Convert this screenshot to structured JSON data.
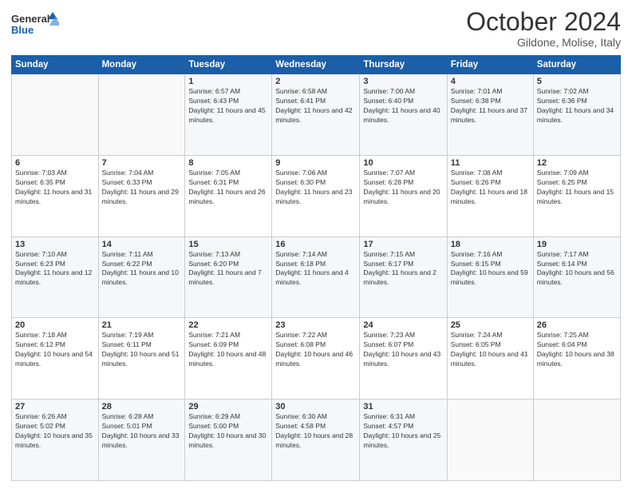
{
  "header": {
    "title": "October 2024",
    "location": "Gildone, Molise, Italy"
  },
  "calendar": {
    "days": [
      "Sunday",
      "Monday",
      "Tuesday",
      "Wednesday",
      "Thursday",
      "Friday",
      "Saturday"
    ]
  },
  "weeks": [
    [
      {
        "day": "",
        "sunrise": "",
        "sunset": "",
        "daylight": ""
      },
      {
        "day": "",
        "sunrise": "",
        "sunset": "",
        "daylight": ""
      },
      {
        "day": "1",
        "sunrise": "Sunrise: 6:57 AM",
        "sunset": "Sunset: 6:43 PM",
        "daylight": "Daylight: 11 hours and 45 minutes."
      },
      {
        "day": "2",
        "sunrise": "Sunrise: 6:58 AM",
        "sunset": "Sunset: 6:41 PM",
        "daylight": "Daylight: 11 hours and 42 minutes."
      },
      {
        "day": "3",
        "sunrise": "Sunrise: 7:00 AM",
        "sunset": "Sunset: 6:40 PM",
        "daylight": "Daylight: 11 hours and 40 minutes."
      },
      {
        "day": "4",
        "sunrise": "Sunrise: 7:01 AM",
        "sunset": "Sunset: 6:38 PM",
        "daylight": "Daylight: 11 hours and 37 minutes."
      },
      {
        "day": "5",
        "sunrise": "Sunrise: 7:02 AM",
        "sunset": "Sunset: 6:36 PM",
        "daylight": "Daylight: 11 hours and 34 minutes."
      }
    ],
    [
      {
        "day": "6",
        "sunrise": "Sunrise: 7:03 AM",
        "sunset": "Sunset: 6:35 PM",
        "daylight": "Daylight: 11 hours and 31 minutes."
      },
      {
        "day": "7",
        "sunrise": "Sunrise: 7:04 AM",
        "sunset": "Sunset: 6:33 PM",
        "daylight": "Daylight: 11 hours and 29 minutes."
      },
      {
        "day": "8",
        "sunrise": "Sunrise: 7:05 AM",
        "sunset": "Sunset: 6:31 PM",
        "daylight": "Daylight: 11 hours and 26 minutes."
      },
      {
        "day": "9",
        "sunrise": "Sunrise: 7:06 AM",
        "sunset": "Sunset: 6:30 PM",
        "daylight": "Daylight: 11 hours and 23 minutes."
      },
      {
        "day": "10",
        "sunrise": "Sunrise: 7:07 AM",
        "sunset": "Sunset: 6:28 PM",
        "daylight": "Daylight: 11 hours and 20 minutes."
      },
      {
        "day": "11",
        "sunrise": "Sunrise: 7:08 AM",
        "sunset": "Sunset: 6:26 PM",
        "daylight": "Daylight: 11 hours and 18 minutes."
      },
      {
        "day": "12",
        "sunrise": "Sunrise: 7:09 AM",
        "sunset": "Sunset: 6:25 PM",
        "daylight": "Daylight: 11 hours and 15 minutes."
      }
    ],
    [
      {
        "day": "13",
        "sunrise": "Sunrise: 7:10 AM",
        "sunset": "Sunset: 6:23 PM",
        "daylight": "Daylight: 11 hours and 12 minutes."
      },
      {
        "day": "14",
        "sunrise": "Sunrise: 7:11 AM",
        "sunset": "Sunset: 6:22 PM",
        "daylight": "Daylight: 11 hours and 10 minutes."
      },
      {
        "day": "15",
        "sunrise": "Sunrise: 7:13 AM",
        "sunset": "Sunset: 6:20 PM",
        "daylight": "Daylight: 11 hours and 7 minutes."
      },
      {
        "day": "16",
        "sunrise": "Sunrise: 7:14 AM",
        "sunset": "Sunset: 6:18 PM",
        "daylight": "Daylight: 11 hours and 4 minutes."
      },
      {
        "day": "17",
        "sunrise": "Sunrise: 7:15 AM",
        "sunset": "Sunset: 6:17 PM",
        "daylight": "Daylight: 11 hours and 2 minutes."
      },
      {
        "day": "18",
        "sunrise": "Sunrise: 7:16 AM",
        "sunset": "Sunset: 6:15 PM",
        "daylight": "Daylight: 10 hours and 59 minutes."
      },
      {
        "day": "19",
        "sunrise": "Sunrise: 7:17 AM",
        "sunset": "Sunset: 6:14 PM",
        "daylight": "Daylight: 10 hours and 56 minutes."
      }
    ],
    [
      {
        "day": "20",
        "sunrise": "Sunrise: 7:18 AM",
        "sunset": "Sunset: 6:12 PM",
        "daylight": "Daylight: 10 hours and 54 minutes."
      },
      {
        "day": "21",
        "sunrise": "Sunrise: 7:19 AM",
        "sunset": "Sunset: 6:11 PM",
        "daylight": "Daylight: 10 hours and 51 minutes."
      },
      {
        "day": "22",
        "sunrise": "Sunrise: 7:21 AM",
        "sunset": "Sunset: 6:09 PM",
        "daylight": "Daylight: 10 hours and 48 minutes."
      },
      {
        "day": "23",
        "sunrise": "Sunrise: 7:22 AM",
        "sunset": "Sunset: 6:08 PM",
        "daylight": "Daylight: 10 hours and 46 minutes."
      },
      {
        "day": "24",
        "sunrise": "Sunrise: 7:23 AM",
        "sunset": "Sunset: 6:07 PM",
        "daylight": "Daylight: 10 hours and 43 minutes."
      },
      {
        "day": "25",
        "sunrise": "Sunrise: 7:24 AM",
        "sunset": "Sunset: 6:05 PM",
        "daylight": "Daylight: 10 hours and 41 minutes."
      },
      {
        "day": "26",
        "sunrise": "Sunrise: 7:25 AM",
        "sunset": "Sunset: 6:04 PM",
        "daylight": "Daylight: 10 hours and 38 minutes."
      }
    ],
    [
      {
        "day": "27",
        "sunrise": "Sunrise: 6:26 AM",
        "sunset": "Sunset: 5:02 PM",
        "daylight": "Daylight: 10 hours and 35 minutes."
      },
      {
        "day": "28",
        "sunrise": "Sunrise: 6:28 AM",
        "sunset": "Sunset: 5:01 PM",
        "daylight": "Daylight: 10 hours and 33 minutes."
      },
      {
        "day": "29",
        "sunrise": "Sunrise: 6:29 AM",
        "sunset": "Sunset: 5:00 PM",
        "daylight": "Daylight: 10 hours and 30 minutes."
      },
      {
        "day": "30",
        "sunrise": "Sunrise: 6:30 AM",
        "sunset": "Sunset: 4:58 PM",
        "daylight": "Daylight: 10 hours and 28 minutes."
      },
      {
        "day": "31",
        "sunrise": "Sunrise: 6:31 AM",
        "sunset": "Sunset: 4:57 PM",
        "daylight": "Daylight: 10 hours and 25 minutes."
      },
      {
        "day": "",
        "sunrise": "",
        "sunset": "",
        "daylight": ""
      },
      {
        "day": "",
        "sunrise": "",
        "sunset": "",
        "daylight": ""
      }
    ]
  ]
}
